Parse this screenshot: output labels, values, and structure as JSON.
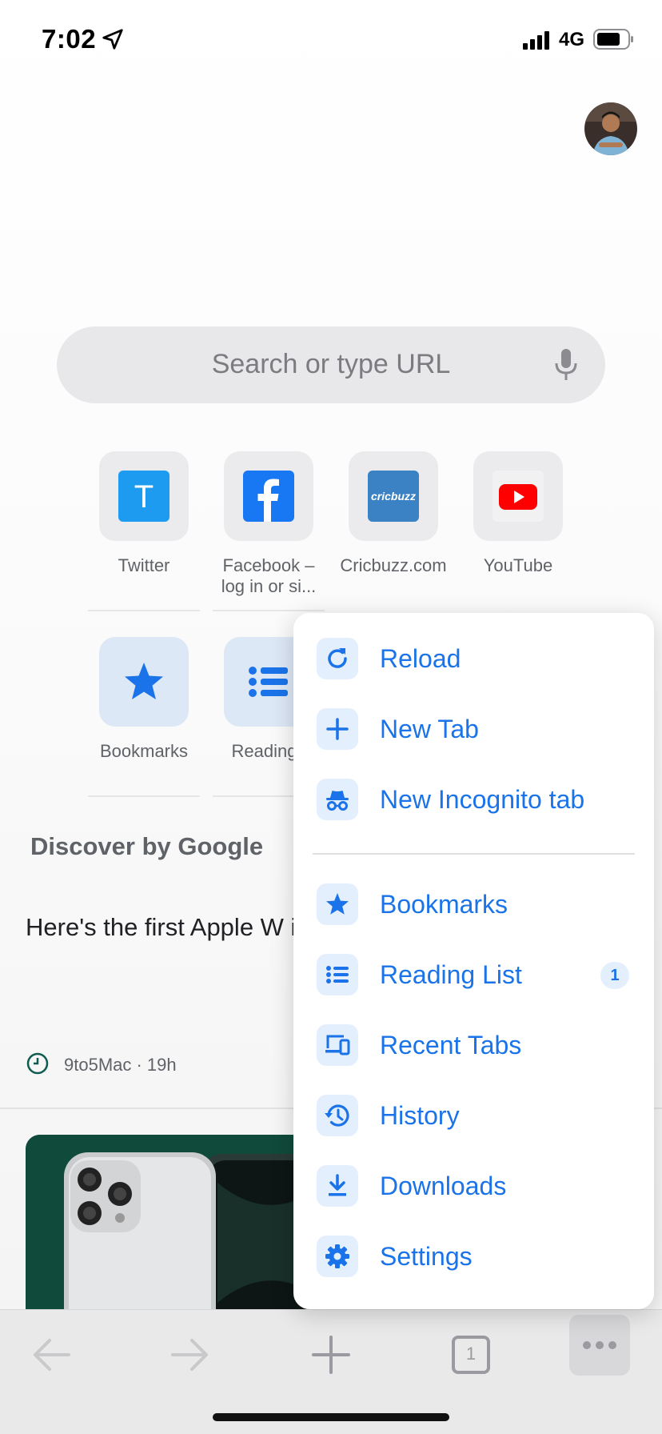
{
  "status_bar": {
    "time": "7:02",
    "network": "4G",
    "icons": [
      "location-arrow-icon",
      "signal-icon",
      "battery-icon"
    ]
  },
  "omnibox": {
    "placeholder": "Search or type URL",
    "icon": "microphone-icon"
  },
  "shortcuts": [
    {
      "label": "Twitter",
      "icon": "twitter-icon"
    },
    {
      "label": "Facebook – log in or si...",
      "icon": "facebook-icon"
    },
    {
      "label": "Cricbuzz.com",
      "icon": "cricbuzz-icon",
      "icon_text": "cricbuzz"
    },
    {
      "label": "YouTube",
      "icon": "youtube-icon"
    },
    {
      "label": "Bookmarks",
      "icon": "star-icon"
    },
    {
      "label": "Reading l",
      "icon": "list-icon"
    }
  ],
  "feed": {
    "section_title": "Discover by Google",
    "article": {
      "title": "Here's the first Apple W implementation of offi",
      "source_time": "9to5Mac · 19h"
    }
  },
  "menu": {
    "items": [
      {
        "label": "Reload",
        "icon": "reload-icon"
      },
      {
        "label": "New Tab",
        "icon": "plus-icon"
      },
      {
        "label": "New Incognito tab",
        "icon": "incognito-icon"
      },
      {
        "label": "Bookmarks",
        "icon": "star-icon"
      },
      {
        "label": "Reading List",
        "icon": "list-icon",
        "badge": "1"
      },
      {
        "label": "Recent Tabs",
        "icon": "devices-icon"
      },
      {
        "label": "History",
        "icon": "history-icon"
      },
      {
        "label": "Downloads",
        "icon": "download-icon"
      },
      {
        "label": "Settings",
        "icon": "gear-icon"
      }
    ]
  },
  "toolbar": {
    "tab_count": "1",
    "icons": [
      "back-arrow-icon",
      "forward-arrow-icon",
      "plus-icon",
      "tab-switcher-icon",
      "more-icon"
    ]
  },
  "colors": {
    "accent": "#1a73e8",
    "menu_icon_bg": "#e3effc",
    "twitter": "#1d9bf0",
    "facebook": "#1877f2",
    "cricbuzz": "#3b82c4",
    "youtube": "#ff0000"
  }
}
